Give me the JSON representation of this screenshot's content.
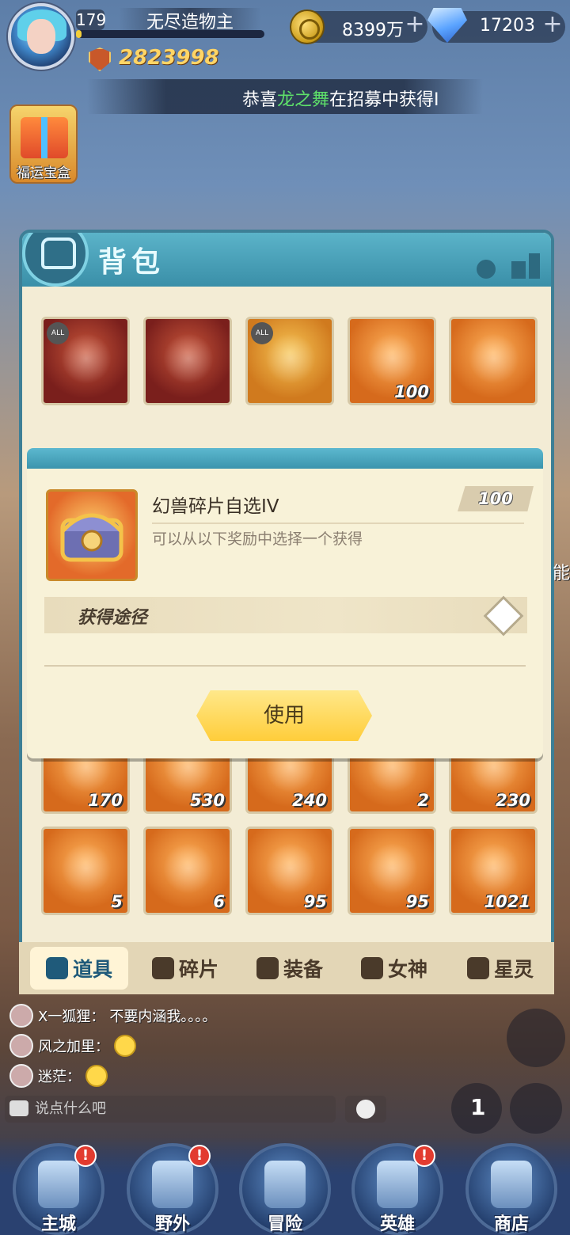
{
  "player": {
    "level": "179",
    "name": "无尽造物主",
    "power": "2823998",
    "exp_fraction": 0.03
  },
  "resources": {
    "gold": "8399万",
    "gems": "17203"
  },
  "ticker": {
    "prefix": "恭喜",
    "highlight": "龙之舞",
    "suffix": "在招募中获得I"
  },
  "side": {
    "lucky_box_label": "福运宝盒"
  },
  "bag": {
    "title": "背包",
    "row1": [
      {
        "icon": "red-mask-all",
        "tag": "ALL",
        "qty": ""
      },
      {
        "icon": "red-mask-star",
        "tag": "",
        "qty": ""
      },
      {
        "icon": "gold-mask-5star",
        "tag": "ALL",
        "qty": ""
      },
      {
        "icon": "beast-chest",
        "qty": "100"
      },
      {
        "icon": "crystal-orb",
        "qty": ""
      }
    ],
    "row_lower1": [
      {
        "icon": "star-shard",
        "qty": "170"
      },
      {
        "icon": "dark-scroll",
        "qty": "530"
      },
      {
        "icon": "dark-gem",
        "qty": "240"
      },
      {
        "icon": "card-frame",
        "qty": "2"
      },
      {
        "icon": "puzzle-piece",
        "qty": "230"
      }
    ],
    "row_lower2": [
      {
        "icon": "red-card",
        "qty": "5"
      },
      {
        "icon": "golden-wheel",
        "qty": "6"
      },
      {
        "icon": "ship-wheel",
        "qty": "95"
      },
      {
        "icon": "arrow-shard",
        "qty": "95"
      },
      {
        "icon": "dark-cylinder",
        "qty": "1021"
      }
    ],
    "tabs": [
      {
        "label": "道具",
        "icon": "items-icon",
        "active": true
      },
      {
        "label": "碎片",
        "icon": "fragment-icon",
        "active": false
      },
      {
        "label": "装备",
        "icon": "equipment-icon",
        "active": false
      },
      {
        "label": "女神",
        "icon": "goddess-icon",
        "active": false
      },
      {
        "label": "星灵",
        "icon": "star-spirit-icon",
        "active": false
      }
    ]
  },
  "dialog": {
    "item_name": "幻兽碎片自选IV",
    "count": "100",
    "description": "可以从以下奖励中选择一个获得",
    "obtain_label": "获得途径",
    "use_button": "使用"
  },
  "chat": {
    "messages": [
      {
        "user": "X一狐狸：",
        "text": "不要内涵我。。。。"
      },
      {
        "user": "风之加里：",
        "text": ""
      },
      {
        "user": "迷茫：",
        "text": ""
      }
    ],
    "placeholder": "说点什么吧"
  },
  "nav": [
    {
      "label": "主城",
      "badge": "!"
    },
    {
      "label": "野外",
      "badge": "!"
    },
    {
      "label": "冒险",
      "badge": ""
    },
    {
      "label": "英雄",
      "badge": "!"
    },
    {
      "label": "商店",
      "badge": ""
    }
  ],
  "side_right": {
    "rank_label": "1",
    "partial_text": "能"
  },
  "colors": {
    "accent_teal": "#3d7f96",
    "button_yellow": "#ffcd3a",
    "highlight_green": "#5ee06a",
    "power_gold": "#ffd566"
  }
}
